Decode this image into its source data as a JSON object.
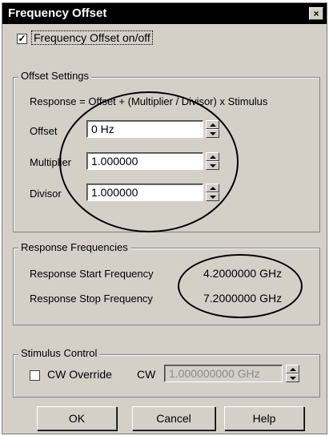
{
  "window": {
    "title": "Frequency Offset",
    "close_glyph": "×"
  },
  "offset_toggle": {
    "checked": true,
    "label": "Frequency Offset on/off"
  },
  "offset_settings": {
    "title": "Offset Settings",
    "formula": "Response  =  Offset + (Multiplier / Divisor) x Stimulus",
    "offset_label": "Offset",
    "offset_value": "0 Hz",
    "multiplier_label": "Multiplier",
    "multiplier_value": "1.000000",
    "divisor_label": "Divisor",
    "divisor_value": "1.000000"
  },
  "response_frequencies": {
    "title": "Response Frequencies",
    "start_label": "Response Start Frequency",
    "start_value": "4.2000000 GHz",
    "stop_label": "Response Stop Frequency",
    "stop_value": "7.2000000 GHz"
  },
  "stimulus_control": {
    "title": "Stimulus Control",
    "cw_override_checked": false,
    "cw_override_label": "CW Override",
    "cw_label": "CW",
    "cw_value": "1.000000000 GHz"
  },
  "buttons": {
    "ok": "OK",
    "cancel": "Cancel",
    "help": "Help"
  },
  "colors": {
    "face": "#d4d0c8",
    "title_bar": "#000000"
  }
}
